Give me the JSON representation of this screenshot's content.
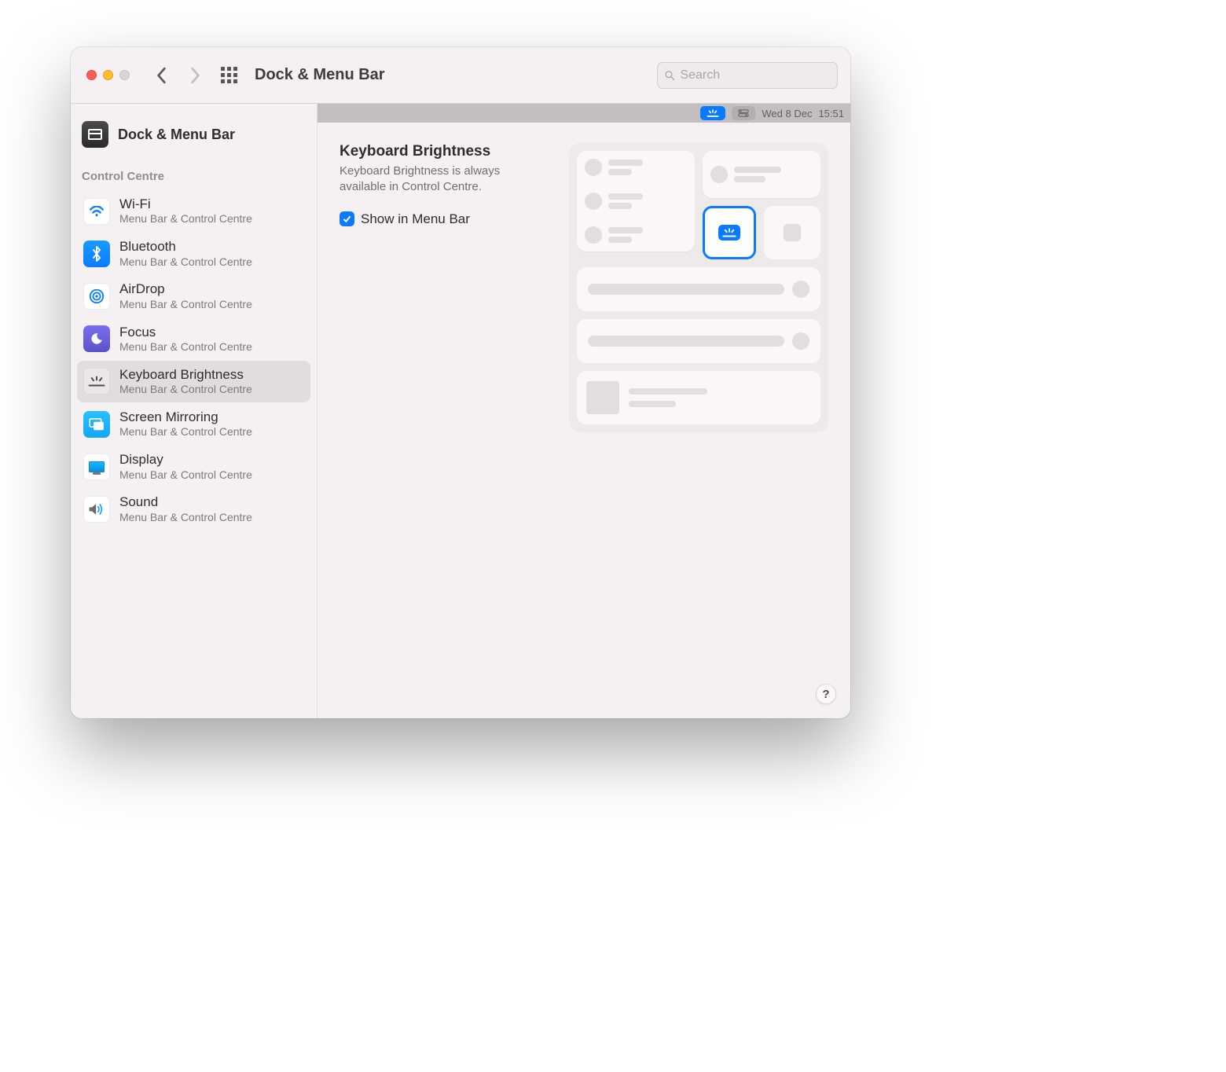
{
  "window": {
    "title": "Dock & Menu Bar"
  },
  "search": {
    "placeholder": "Search"
  },
  "sidebar": {
    "header": {
      "label": "Dock & Menu Bar"
    },
    "section_label": "Control Centre",
    "items": [
      {
        "label": "Wi-Fi",
        "sub": "Menu Bar & Control Centre",
        "icon": "wifi-icon"
      },
      {
        "label": "Bluetooth",
        "sub": "Menu Bar & Control Centre",
        "icon": "bluetooth-icon"
      },
      {
        "label": "AirDrop",
        "sub": "Menu Bar & Control Centre",
        "icon": "airdrop-icon"
      },
      {
        "label": "Focus",
        "sub": "Menu Bar & Control Centre",
        "icon": "moon-icon"
      },
      {
        "label": "Keyboard Brightness",
        "sub": "Menu Bar & Control Centre",
        "icon": "keyboard-brightness-icon",
        "selected": true
      },
      {
        "label": "Screen Mirroring",
        "sub": "Menu Bar & Control Centre",
        "icon": "screen-mirroring-icon"
      },
      {
        "label": "Display",
        "sub": "Menu Bar & Control Centre",
        "icon": "display-icon"
      },
      {
        "label": "Sound",
        "sub": "Menu Bar & Control Centre",
        "icon": "sound-icon"
      }
    ]
  },
  "pane": {
    "heading": "Keyboard Brightness",
    "description": "Keyboard Brightness is always available in Control Centre.",
    "check_label": "Show in Menu Bar",
    "checked": true
  },
  "menubar_preview": {
    "date": "Wed 8 Dec",
    "time": "15:51"
  },
  "help": {
    "glyph": "?"
  }
}
